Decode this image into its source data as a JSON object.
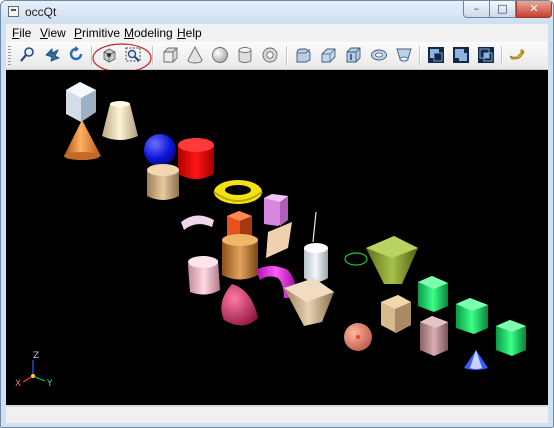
{
  "window": {
    "title": "occQt"
  },
  "menu": {
    "items": [
      {
        "label": "File",
        "accel": "F",
        "rest": "ile"
      },
      {
        "label": "View",
        "accel": "V",
        "rest": "iew"
      },
      {
        "label": "Primitive",
        "accel": "P",
        "rest": "rimitive"
      },
      {
        "label": "Modeling",
        "accel": "M",
        "rest": "odeling"
      },
      {
        "label": "Help",
        "accel": "H",
        "rest": "elp"
      }
    ]
  },
  "toolbar": {
    "groups": [
      [
        "zoom-icon",
        "pan-icon",
        "rotate-icon"
      ],
      [
        "reset-view-icon",
        "fit-all-icon"
      ],
      [
        "box-icon",
        "cone-icon",
        "sphere-icon",
        "cylinder-icon",
        "torus-icon"
      ],
      [
        "fillet-icon",
        "chamfer-icon",
        "extrude-icon",
        "revolve-icon",
        "loft-icon"
      ],
      [
        "cut-icon",
        "fuse-icon",
        "common-icon"
      ],
      [
        "about-icon"
      ]
    ],
    "highlighted": [
      "reset-view-icon",
      "fit-all-icon"
    ],
    "annotation_color": "#cc1f1f"
  },
  "viewer": {
    "background": "#000000",
    "trihedron": {
      "z": "Z",
      "x": "X",
      "y": "Y"
    }
  },
  "colors": {
    "accent": "#cc1f1f",
    "title_bar": "#cfe0f2",
    "close_button": "#c7402c"
  }
}
